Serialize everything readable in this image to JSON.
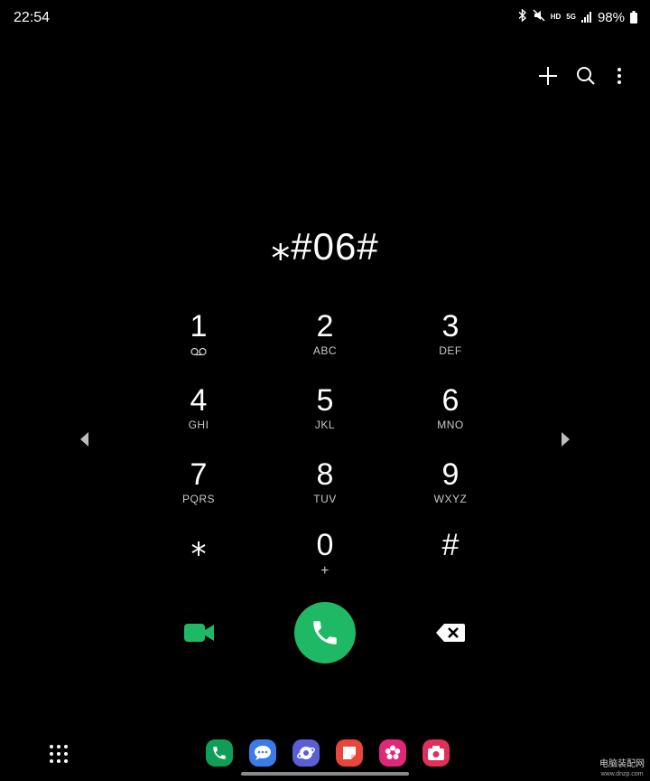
{
  "status_bar": {
    "time": "22:54",
    "hd_label": "HD",
    "network_label": "5G",
    "battery": "98%",
    "icons": [
      "bluetooth-icon",
      "mute-icon",
      "signal-icon",
      "battery-icon"
    ]
  },
  "top_actions": [
    "add-contact-icon",
    "search-icon",
    "more-options-icon"
  ],
  "dial_number": "⁎#06#",
  "keypad": [
    {
      "digit": "1",
      "letters": ""
    },
    {
      "digit": "2",
      "letters": "ABC"
    },
    {
      "digit": "3",
      "letters": "DEF"
    },
    {
      "digit": "4",
      "letters": "GHI"
    },
    {
      "digit": "5",
      "letters": "JKL"
    },
    {
      "digit": "6",
      "letters": "MNO"
    },
    {
      "digit": "7",
      "letters": "PQRS"
    },
    {
      "digit": "8",
      "letters": "TUV"
    },
    {
      "digit": "9",
      "letters": "WXYZ"
    },
    {
      "digit": "⁎",
      "letters": ""
    },
    {
      "digit": "0",
      "letters": "+"
    },
    {
      "digit": "#",
      "letters": ""
    }
  ],
  "actions": {
    "video_call_icon": "video-call-icon",
    "call_icon": "phone-icon",
    "backspace_icon": "backspace-icon"
  },
  "dock_apps": [
    "phone-app-icon",
    "messages-app-icon",
    "internet-app-icon",
    "notes-app-icon",
    "gallery-app-icon",
    "camera-app-icon"
  ],
  "colors": {
    "call_green": "#1fb865",
    "video_green": "#1fb865",
    "phone_app": "#0f9d58",
    "messages_app": "#3b7be8",
    "internet_app": "#5b5fd6",
    "notes_app": "#e8453c",
    "gallery_app": "#e0287a",
    "camera_app": "#e0305a"
  },
  "watermark": {
    "line1": "电脑装配网",
    "line2": "www.dnzp.com"
  }
}
